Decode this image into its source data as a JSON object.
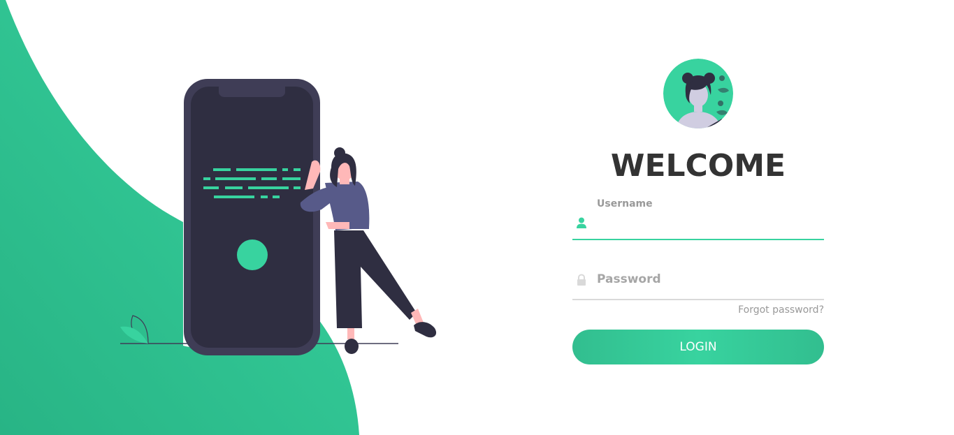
{
  "theme": {
    "accent": "#38d39f",
    "accent_dark": "#32be8f",
    "phone_color": "#3f3d56",
    "text_dark": "#333333",
    "muted": "#999999"
  },
  "login": {
    "avatar_icon": "user-avatar-illustration",
    "welcome": "WELCOME",
    "username": {
      "label": "Username",
      "icon": "user-icon",
      "value": ""
    },
    "password": {
      "label": "Password",
      "icon": "lock-icon",
      "value": ""
    },
    "forgot_link": "Forgot password?",
    "login_button": "LOGIN"
  },
  "illustration": {
    "name": "woman-leaning-on-phone",
    "leaf_icon": "leaf-icon"
  }
}
